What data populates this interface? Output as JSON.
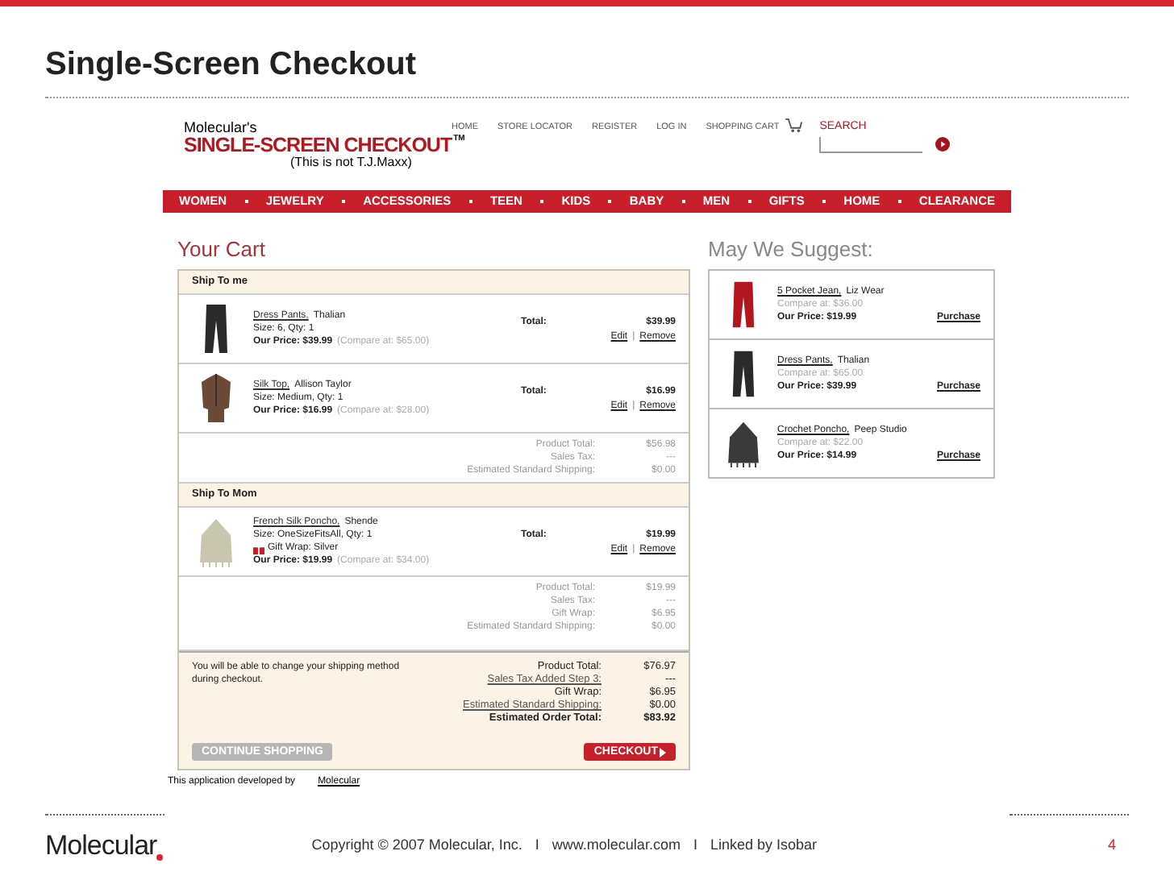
{
  "slide": {
    "title": "Single-Screen Checkout",
    "page_number": "4",
    "footer": {
      "logo": "Molecular",
      "copyright": "Copyright © 2007 Molecular, Inc.",
      "separator_1": "I",
      "website": "www.molecular.com",
      "separator_2": "I",
      "linked_by": "Linked by Isobar"
    }
  },
  "site": {
    "logo": {
      "line1": "Molecular's",
      "line2": "SINGLE-SCREEN CHECKOUT",
      "tm": "TM",
      "subtitle": "(This is not T.J.Maxx)"
    },
    "top_nav": [
      "HOME",
      "STORE LOCATOR",
      "REGISTER",
      "LOG IN",
      "SHOPPING CART"
    ],
    "search": {
      "label": "SEARCH"
    },
    "categories": [
      "WOMEN",
      "JEWELRY",
      "ACCESSORIES",
      "TEEN",
      "KIDS",
      "BABY",
      "MEN",
      "GIFTS",
      "HOME",
      "CLEARANCE"
    ],
    "cart": {
      "title": "Your Cart",
      "groups": [
        {
          "heading": "Ship To me",
          "items": [
            {
              "name": "Dress Pants,",
              "brand": "Thalian",
              "details": [
                "Size: 6, Qty: 1"
              ],
              "price_label": "Our Price: $39.99",
              "compare": "(Compare at: $65.00)",
              "total_label": "Total:",
              "total": "$39.99",
              "edit": "Edit",
              "sep": "|",
              "remove": "Remove"
            },
            {
              "name": "Silk Top,",
              "brand": "Allison Taylor",
              "details": [
                "Size: Medium, Qty: 1"
              ],
              "price_label": "Our Price: $16.99",
              "compare": "(Compare at: $28.00)",
              "total_label": "Total:",
              "total": "$16.99",
              "edit": "Edit",
              "sep": "|",
              "remove": "Remove"
            }
          ],
          "summary": [
            {
              "label": "Product Total:",
              "value": "$56.98"
            },
            {
              "label": "Sales Tax:",
              "value": "---"
            },
            {
              "label": "Estimated Standard Shipping:",
              "value": "$0.00"
            }
          ]
        },
        {
          "heading": "Ship To Mom",
          "items": [
            {
              "name": "French Silk Poncho,",
              "brand": "Shende",
              "details": [
                "Size: OneSizeFitsAll, Qty: 1"
              ],
              "gift_wrap": "Gift Wrap: Silver",
              "price_label": "Our Price: $19.99",
              "compare": "(Compare at: $34.00)",
              "total_label": "Total:",
              "total": "$19.99",
              "edit": "Edit",
              "sep": "|",
              "remove": "Remove"
            }
          ],
          "summary": [
            {
              "label": "Product Total:",
              "value": "$19.99"
            },
            {
              "label": "Sales Tax:",
              "value": "---"
            },
            {
              "label": "Gift Wrap:",
              "value": "$6.95"
            },
            {
              "label": "Estimated Standard Shipping:",
              "value": "$0.00"
            }
          ]
        }
      ],
      "note": "You will be able to change your shipping method during checkout.",
      "totals": [
        {
          "kind": "plain",
          "label": "Product Total:",
          "value": "$76.97"
        },
        {
          "kind": "link",
          "label": "Sales Tax Added Step 3:",
          "value": "---"
        },
        {
          "kind": "plain",
          "label": "Gift Wrap:",
          "value": "$6.95"
        },
        {
          "kind": "link",
          "label": "Estimated Standard Shipping:",
          "value": "$0.00"
        },
        {
          "kind": "bold",
          "label": "Estimated Order Total:",
          "value": "$83.92"
        }
      ],
      "continue_button": "CONTINUE SHOPPING",
      "checkout_button": "CHECKOUT"
    },
    "suggest": {
      "title": "May We Suggest:",
      "items": [
        {
          "name": "5 Pocket Jean,",
          "brand": "Liz Wear",
          "compare": "Compare at: $36.00",
          "price_label": "Our Price: $19.99",
          "action": "Purchase"
        },
        {
          "name": "Dress Pants,",
          "brand": "Thalian",
          "compare": "Compare at: $65.00",
          "price_label": "Our Price: $39.99",
          "action": "Purchase"
        },
        {
          "name": "Crochet Poncho,",
          "brand": "Peep Studio",
          "compare": "Compare at: $22.00",
          "price_label": "Our Price: $14.99",
          "action": "Purchase"
        }
      ]
    },
    "credit": {
      "text": "This application developed by",
      "link": "Molecular"
    }
  }
}
